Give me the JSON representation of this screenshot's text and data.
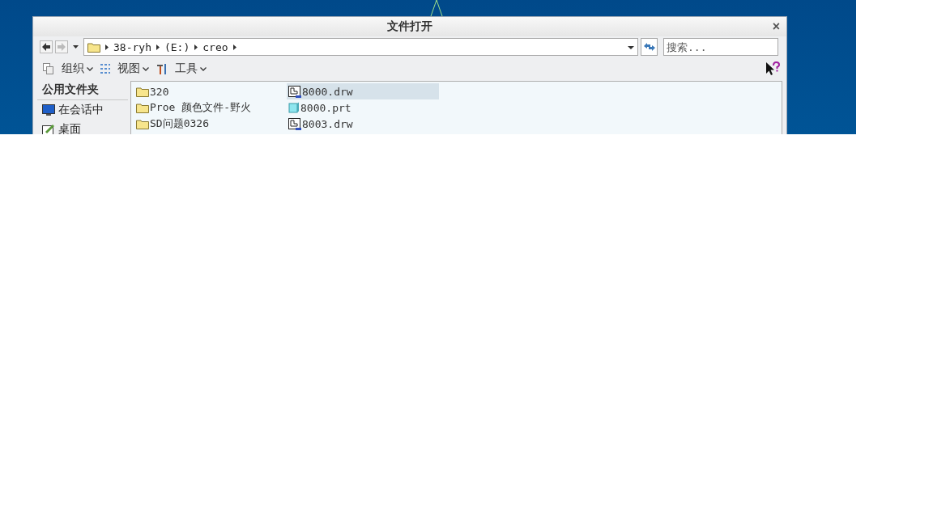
{
  "window": {
    "title": "文件打开",
    "close": "×"
  },
  "address": {
    "crumbs": [
      "38-ryh",
      "(E:)",
      "creo"
    ]
  },
  "search": {
    "placeholder": "搜索..."
  },
  "toolbar": {
    "items": [
      {
        "kind": "organize",
        "label": "组织"
      },
      {
        "kind": "view",
        "label": "视图"
      },
      {
        "kind": "tools",
        "label": "工具"
      }
    ]
  },
  "sidebar": {
    "header": "公用文件夹",
    "items": [
      {
        "kind": "session",
        "label": "在会话中"
      },
      {
        "kind": "desktop",
        "label": "桌面"
      }
    ]
  },
  "files": {
    "columns": [
      [
        {
          "kind": "folder",
          "name": "320",
          "selected": false
        },
        {
          "kind": "folder",
          "name": "Proe 颜色文件-野火",
          "selected": false
        },
        {
          "kind": "folder",
          "name": "SD问题0326",
          "selected": false
        }
      ],
      [
        {
          "kind": "drw",
          "name": "8000.drw",
          "selected": true
        },
        {
          "kind": "prt",
          "name": "8000.prt",
          "selected": false
        },
        {
          "kind": "drw",
          "name": "8003.drw",
          "selected": false
        }
      ]
    ]
  }
}
